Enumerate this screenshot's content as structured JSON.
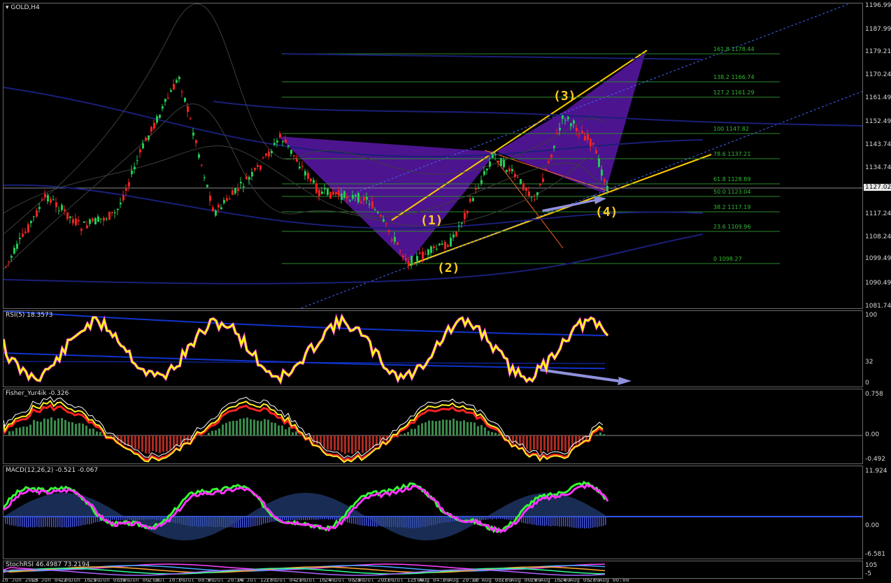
{
  "main": {
    "title": "GOLD,H4",
    "current_price": "1127.02",
    "price_ticks": [
      "1196.99",
      "1187.99",
      "1179.21",
      "1170.24",
      "1161.49",
      "1152.49",
      "1143.74",
      "1134.74",
      "1117.24",
      "1108.24",
      "1099.49",
      "1090.49",
      "1081.74"
    ],
    "fib_levels": [
      {
        "label": "161.8 1178.44"
      },
      {
        "label": "138.2 1166.74"
      },
      {
        "label": "127.2 1161.29"
      },
      {
        "label": "100 1147.82"
      },
      {
        "label": "78.6 1137.21"
      },
      {
        "label": "61.8 1128.89"
      },
      {
        "label": "50.0 1123.04"
      },
      {
        "label": "38.2 1117.19"
      },
      {
        "label": "23.6 1109.96"
      },
      {
        "label": "0 1098.27"
      }
    ],
    "waves": [
      "(1)",
      "(2)",
      "(3)",
      "(4)"
    ]
  },
  "rsi": {
    "title": "RSI(5) 18.3573",
    "ticks": [
      "100",
      "32",
      "0"
    ]
  },
  "fisher": {
    "title": "Fisher_Yur4ik -0.326",
    "ticks": [
      "0.758",
      "0.00",
      "-0.492"
    ]
  },
  "macd": {
    "title": "MACD(12,26,2) -0.521 -0.067",
    "ticks": [
      "11.924",
      "0.00",
      "-6.581"
    ]
  },
  "stoch": {
    "title": "StochRSI 46.4987 73.2194",
    "ticks": [
      "105",
      "-5"
    ]
  },
  "time_labels": [
    "16 Jun 2015",
    "18 Jun 04:00",
    "22 Jun 16:00",
    "25 Jun 08:00",
    "30 Jun 00:00",
    "2 Jul 16:00",
    "7 Jul 08:00",
    "9 Jul 20:00",
    "14 Jul 12:00",
    "17 Jul 04:00",
    "21 Jul 16:00",
    "24 Jul 08:00",
    "28 Jul 20:00",
    "31 Jul 12:00",
    "5 Aug 04:00",
    "7 Aug 20:00",
    "12 Aug 08:00",
    "17 Aug 00:00",
    "19 Aug 16:00",
    "24 Aug 08:00",
    "27 Aug 00:00"
  ],
  "colors": {
    "bull": "#22cc55",
    "bear": "#ee2222",
    "fib": "#2b8a2b",
    "harmonic": "#6b1fb0",
    "trend": "#ffcc00",
    "rsi": "#ffff00",
    "macd_main": "#33ff33",
    "macd_signal": "#ff33ff"
  }
}
